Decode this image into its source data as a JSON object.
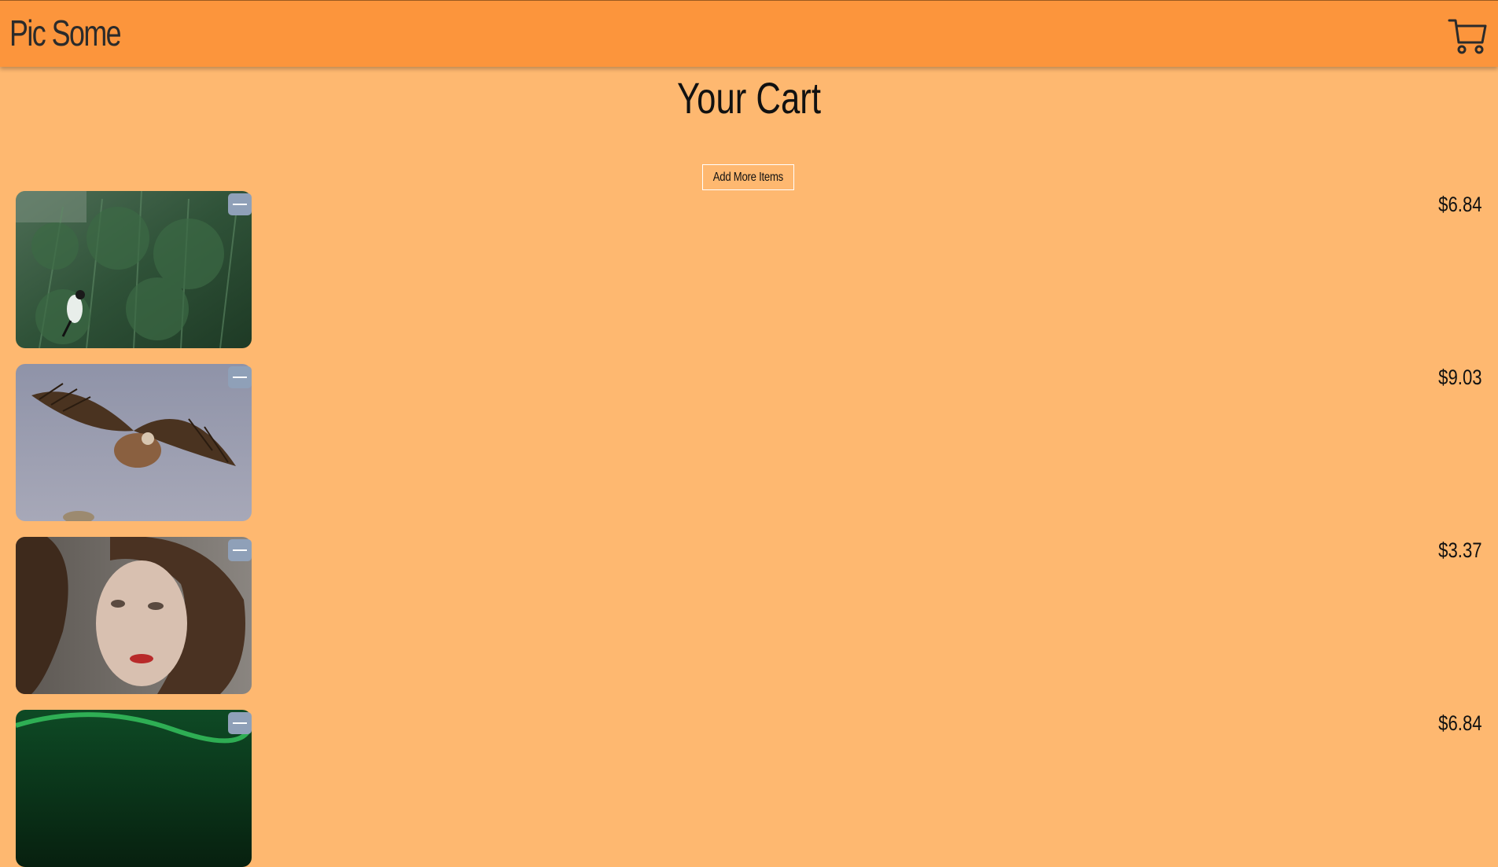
{
  "header": {
    "brand": "Pic Some",
    "cart_icon": "shopping-cart-icon"
  },
  "page": {
    "title": "Your Cart",
    "add_more_label": "Add More Items"
  },
  "items": [
    {
      "image": "motorcyclist in pine forest",
      "remove_icon": "minus-icon",
      "price": "$6.84"
    },
    {
      "image": "vulture in flight",
      "remove_icon": "minus-icon",
      "price": "$9.03"
    },
    {
      "image": "woman portrait curly hair",
      "remove_icon": "minus-icon",
      "price": "$3.37"
    },
    {
      "image": "green aurora night sky",
      "remove_icon": "minus-icon",
      "price": "$6.84"
    }
  ],
  "colors": {
    "header": "#FC953C",
    "background": "#FEB870",
    "remove_button": "#8fa0b8"
  }
}
